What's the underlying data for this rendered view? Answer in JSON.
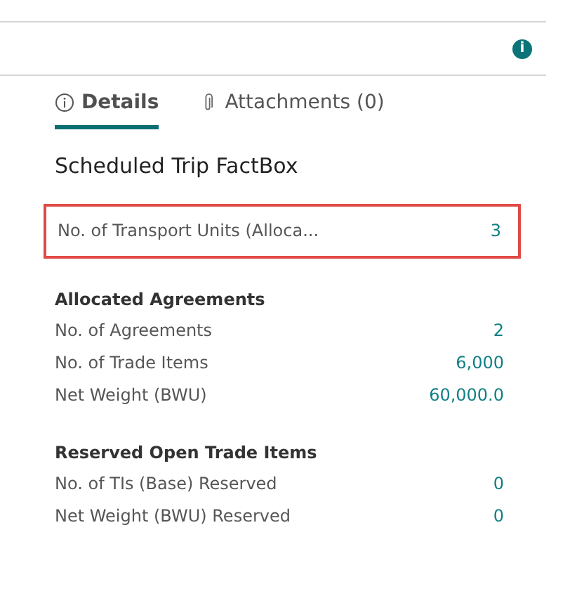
{
  "header": {
    "info_badge": "i"
  },
  "tabs": [
    {
      "label": "Details",
      "selected": true
    },
    {
      "label": "Attachments (0)",
      "selected": false
    }
  ],
  "factbox": {
    "title": "Scheduled Trip FactBox",
    "sections": [
      {
        "rows": [
          {
            "label": "No. of Transport Units (Alloca...",
            "value": "3",
            "highlighted": true
          }
        ]
      },
      {
        "heading": "Allocated Agreements",
        "rows": [
          {
            "label": "No. of Agreements",
            "value": "2",
            "highlighted": false
          },
          {
            "label": "No. of Trade Items",
            "value": "6,000",
            "highlighted": false
          },
          {
            "label": "Net Weight (BWU)",
            "value": "60,000.0",
            "highlighted": false
          }
        ]
      },
      {
        "heading": "Reserved Open Trade Items",
        "rows": [
          {
            "label": "No. of TIs (Base) Reserved",
            "value": "0",
            "highlighted": false
          },
          {
            "label": "Net Weight (BWU) Reserved",
            "value": "0",
            "highlighted": false
          }
        ]
      }
    ]
  }
}
